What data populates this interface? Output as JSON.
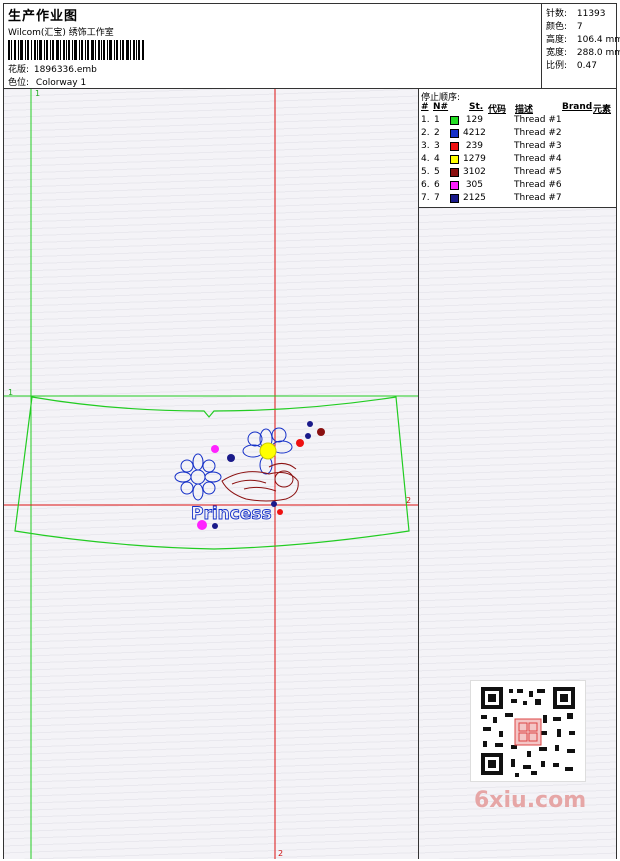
{
  "header": {
    "title": "生产作业图",
    "studio": "Wilcom(汇宝) 绣饰工作室",
    "pattern_label": "花版:",
    "pattern_value": "1896336.emb",
    "colorway_label": "色位:",
    "colorway_value": "Colorway 1"
  },
  "stats": {
    "stitches_label": "针数:",
    "stitches_value": "11393",
    "colors_label": "颜色:",
    "colors_value": "7",
    "height_label": "高度:",
    "height_value": "106.4 mm",
    "width_label": "宽度:",
    "width_value": "288.0 mm",
    "scale_label": "比例:",
    "scale_value": "0.47"
  },
  "sequence": {
    "title": "停止顺序:",
    "headers": {
      "num": "#",
      "n": "N#",
      "st": "St.",
      "code": "代码",
      "desc": "描述",
      "brand": "Brand",
      "element": "元素"
    },
    "rows": [
      {
        "num": "1.",
        "n": "1",
        "st": "129",
        "color": "#22dd22",
        "desc": "Thread #1"
      },
      {
        "num": "2.",
        "n": "2",
        "st": "4212",
        "color": "#1530c8",
        "desc": "Thread #2"
      },
      {
        "num": "3.",
        "n": "3",
        "st": "239",
        "color": "#ee1111",
        "desc": "Thread #3"
      },
      {
        "num": "4.",
        "n": "4",
        "st": "1279",
        "color": "#ffff00",
        "desc": "Thread #4"
      },
      {
        "num": "5.",
        "n": "5",
        "st": "3102",
        "color": "#8b1010",
        "desc": "Thread #5"
      },
      {
        "num": "6.",
        "n": "6",
        "st": "305",
        "color": "#ff22ff",
        "desc": "Thread #6"
      },
      {
        "num": "7.",
        "n": "7",
        "st": "2125",
        "color": "#1a1a8a",
        "desc": "Thread #7"
      }
    ]
  },
  "canvas": {
    "guide_label_top": "1",
    "guide_label_left": "1",
    "guide_label_right": "2",
    "guide_label_bottom": "2",
    "design_text": "Princess"
  },
  "watermark": "6xiu.com",
  "colors": {
    "guide_green": "#22cc22",
    "guide_red": "#dd1111"
  }
}
